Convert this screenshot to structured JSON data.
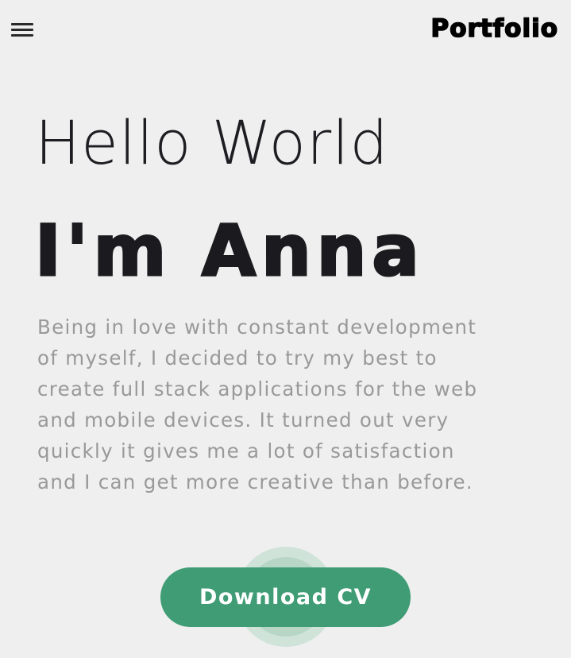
{
  "header": {
    "menu_icon": "hamburger-menu-icon",
    "logo_text": "Portfolio"
  },
  "hero": {
    "greeting": "Hello World",
    "name": "I'm Anna",
    "bio": "Being in love with constant development of myself, I decided to try my best to create full stack applications for the web and mobile devices. It turned out very quickly it gives me a lot of satisfaction and I can get more creative than before."
  },
  "cta": {
    "download_label": "Download CV"
  },
  "colors": {
    "background": "#efefef",
    "text_dark": "#1b1b1f",
    "text_muted": "#999999",
    "accent": "#3f9c74",
    "ripple_light": "#cfe3d9",
    "ripple_mid": "#b7d6c6"
  }
}
